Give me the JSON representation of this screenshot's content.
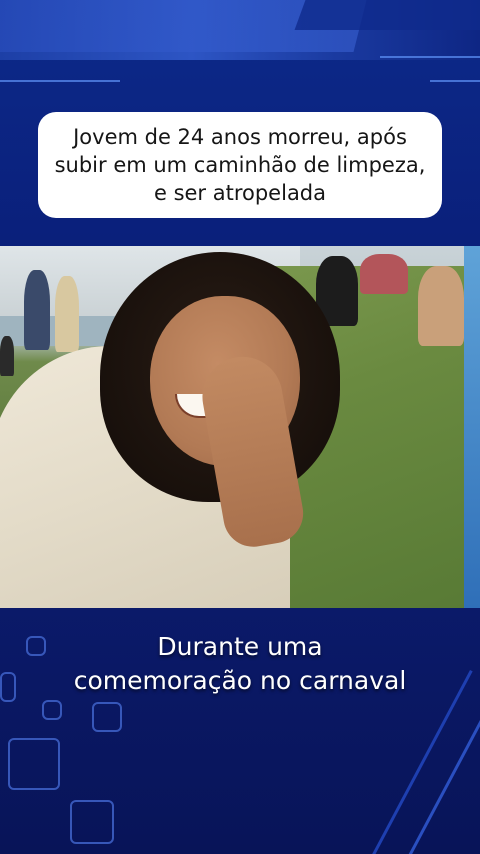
{
  "headline": {
    "text": "Jovem de 24 anos morreu, após subir em um caminhão de limpeza, e ser atropelada"
  },
  "photo": {
    "description_icon": "news-photo"
  },
  "caption": {
    "line1": "Durante uma",
    "line2": "comemoração no carnaval"
  },
  "colors": {
    "background": "#0b1b6e",
    "accent": "#2d55c4",
    "caption_text": "#ffffff",
    "headline_bg": "#ffffff"
  }
}
